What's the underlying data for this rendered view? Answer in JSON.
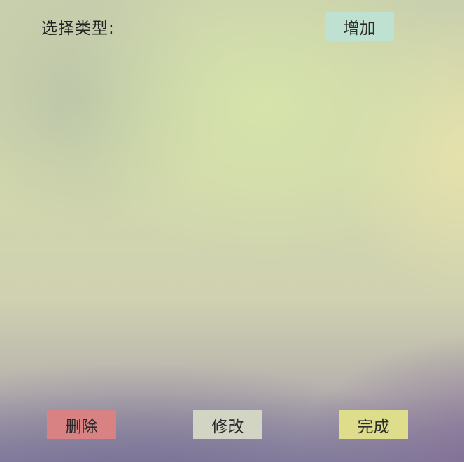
{
  "header": {
    "select_type_label": "选择类型:"
  },
  "buttons": {
    "add": {
      "label": "增加",
      "color": "#bfe1d1"
    },
    "delete": {
      "label": "删除",
      "color": "#d98283"
    },
    "edit": {
      "label": "修改",
      "color": "#d2d4c4"
    },
    "done": {
      "label": "完成",
      "color": "#dedd8c"
    }
  }
}
